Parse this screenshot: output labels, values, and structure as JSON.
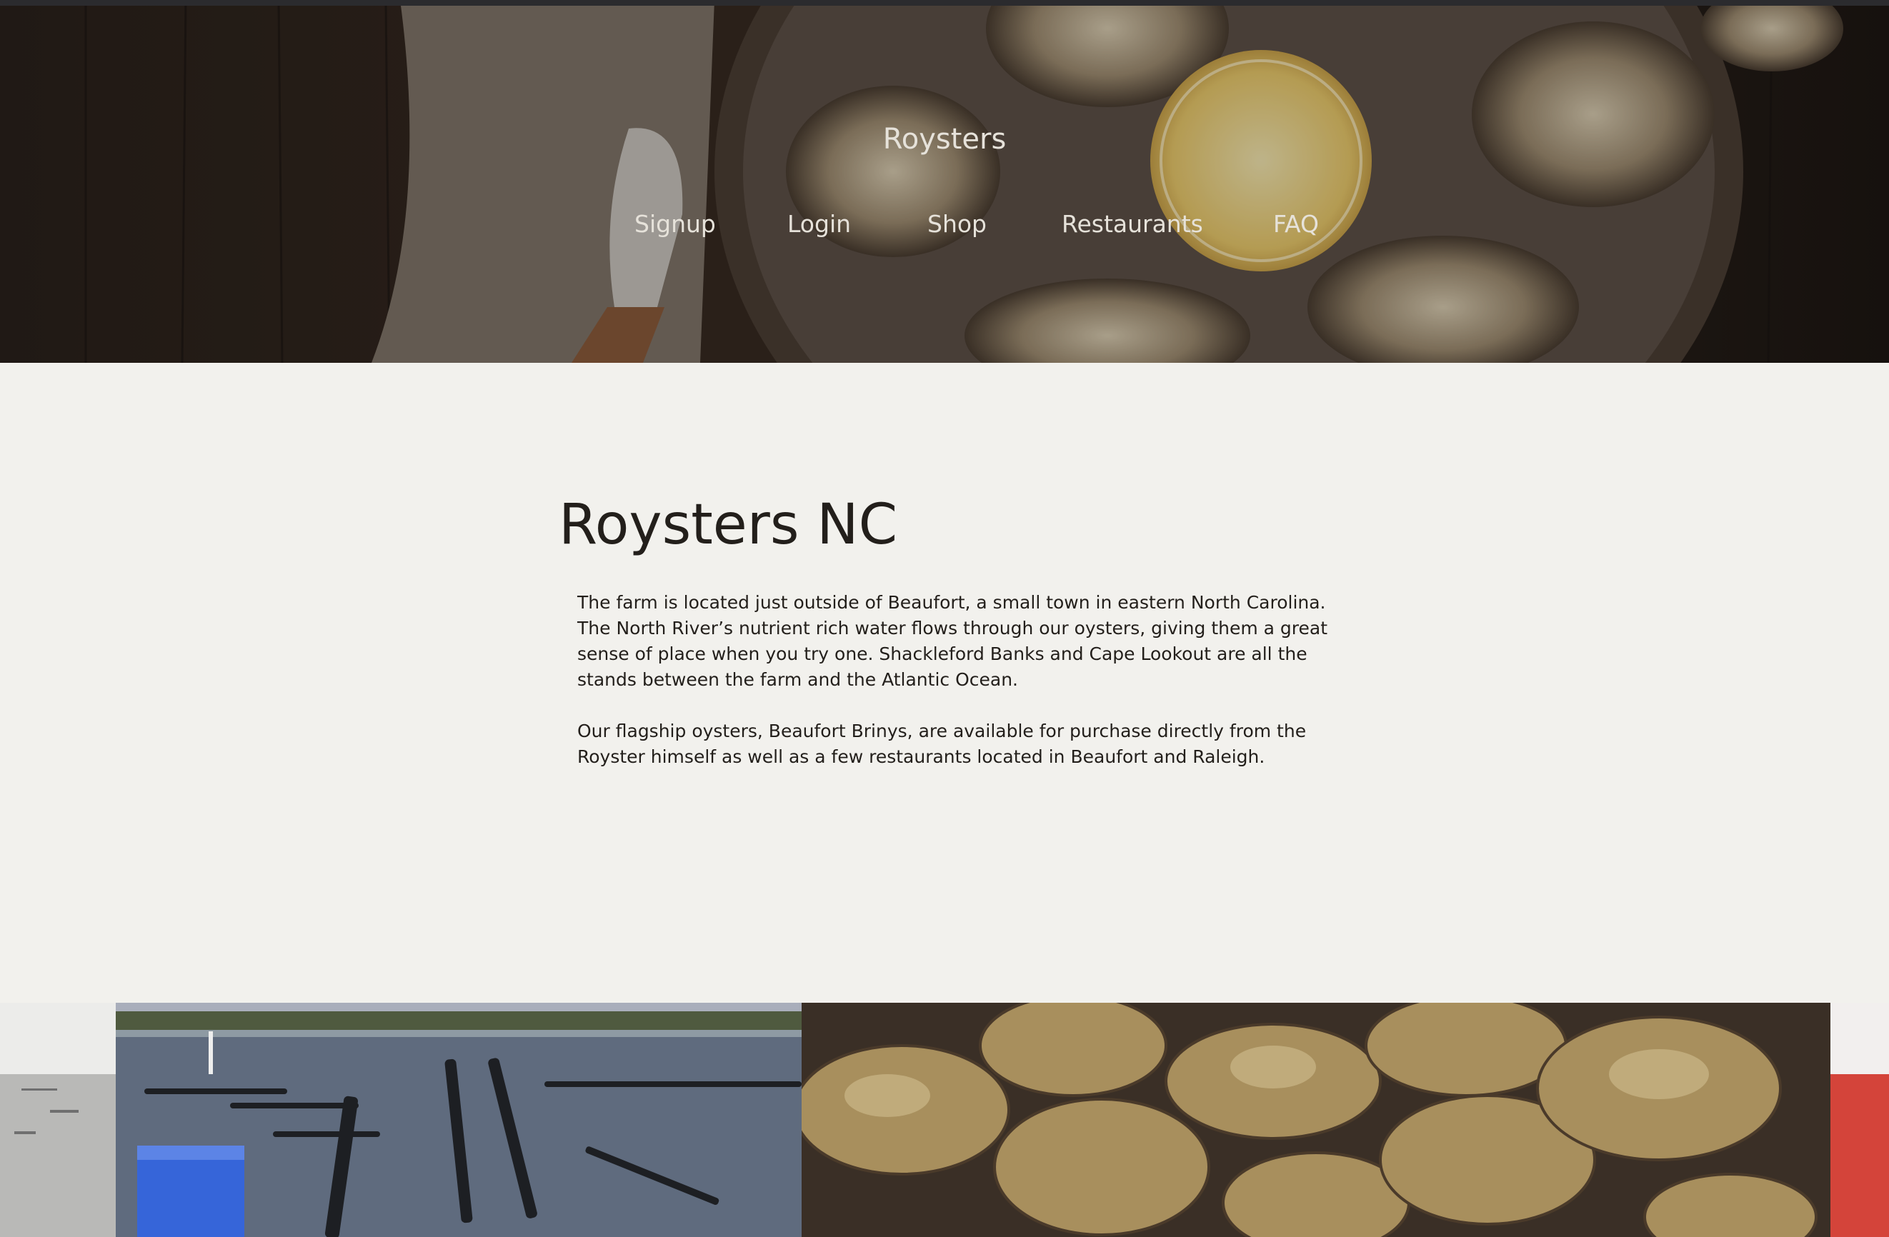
{
  "site": {
    "brand": "Roysters"
  },
  "nav": {
    "items": [
      {
        "label": "Signup"
      },
      {
        "label": "Login"
      },
      {
        "label": "Shop"
      },
      {
        "label": "Restaurants"
      },
      {
        "label": "FAQ"
      }
    ]
  },
  "main": {
    "title": "Roysters NC",
    "paragraphs": [
      "The farm is located just outside of Beaufort, a small town in eastern North Carolina. The North River’s nutrient rich water flows through our oysters, giving them a great sense of place when you try one. Shackleford Banks and Cape Lookout are all the stands between the farm and the Atlantic Ocean.",
      "Our flagship oysters, Beaufort Brinys, are available for purchase directly from the Royster himself as well as a few restaurants located in Beaufort and Raleigh."
    ]
  },
  "colors": {
    "page_background": "#f2f1ed",
    "text": "#231f1b",
    "nav_text": "#e6e2da"
  }
}
